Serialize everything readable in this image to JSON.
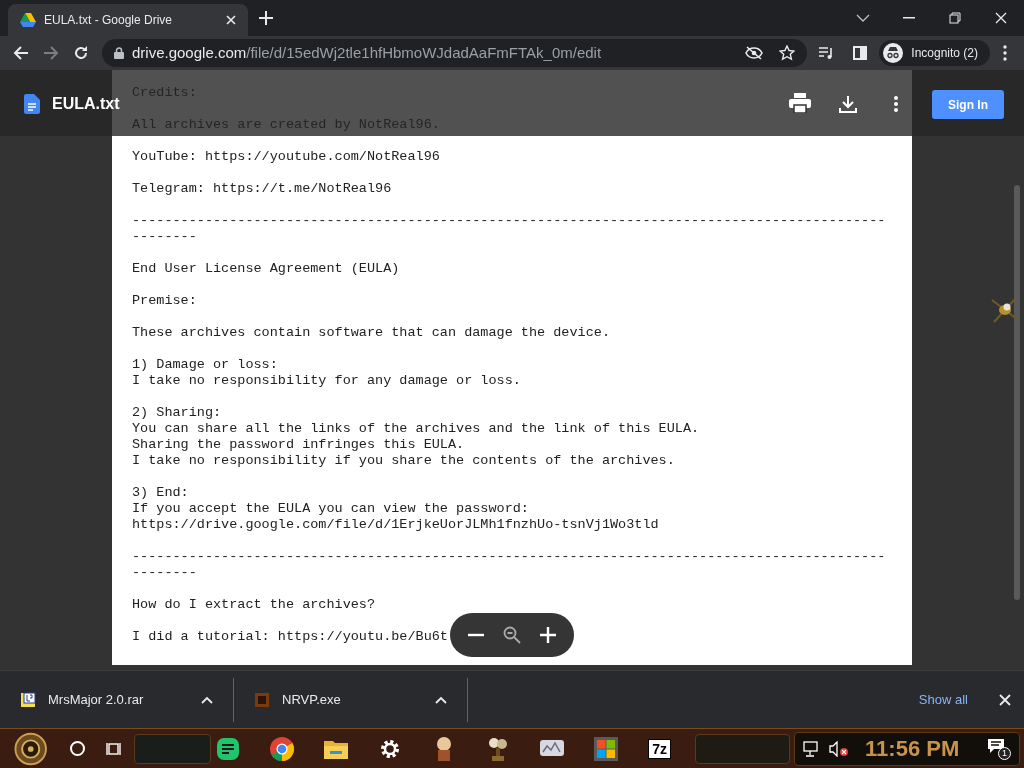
{
  "tabs": [
    {
      "title": "EULA.txt - Google Drive",
      "selected": true
    }
  ],
  "address": {
    "host": "drive.google.com",
    "path": "/file/d/15edWj2tle1hfHbmoWJdadAaFmFTAk_0m/edit"
  },
  "profile": {
    "label": "Incognito (2)"
  },
  "viewer": {
    "file_name": "EULA.txt",
    "sign_in": "Sign In"
  },
  "document": {
    "paragraphs": [
      [
        "Credits:"
      ],
      [
        "All archives are created by NotReal96."
      ],
      [
        "YouTube: https://youtube.com/NotReal96"
      ],
      [
        "Telegram: https://t.me/NotReal96"
      ],
      [
        "-----------------------------------------------------------------------------------------------------"
      ],
      [
        "End User License Agreement (EULA)"
      ],
      [
        "Premise:"
      ],
      [
        "These archives contain software that can damage the device."
      ],
      [
        "1) Damage or loss:",
        "I take no responsibility for any damage or loss."
      ],
      [
        "2) Sharing:",
        "You can share all the links of the archives and the link of this EULA.",
        "Sharing the password infringes this EULA.",
        "I take no responsibility if you share the contents of the archives."
      ],
      [
        "3) End:",
        "If you accept the EULA you can view the password:",
        "https://drive.google.com/file/d/1ErjkeUorJLMh1fnzhUo-tsnVj1Wo3tld"
      ],
      [
        "-----------------------------------------------------------------------------------------------------"
      ],
      [
        "How do I extract the archives?"
      ],
      [
        "I did a tutorial: https://youtu.be/Bu6t"
      ]
    ]
  },
  "downloads": {
    "items": [
      {
        "name": "MrsMajor 2.0.rar",
        "kind": "archive"
      },
      {
        "name": "NRVP.exe",
        "kind": "program"
      }
    ],
    "show_all": "Show all"
  },
  "taskbar": {
    "apps": [
      {
        "kind": "sheet"
      },
      {
        "kind": "chrome"
      },
      {
        "kind": "folder"
      },
      {
        "kind": "gear"
      },
      {
        "kind": "figure"
      },
      {
        "kind": "plant"
      },
      {
        "kind": "monitor"
      },
      {
        "kind": "store"
      },
      {
        "kind": "sevenzip",
        "label": "7z"
      }
    ],
    "clock": "11:56 PM",
    "notifications": "1"
  }
}
